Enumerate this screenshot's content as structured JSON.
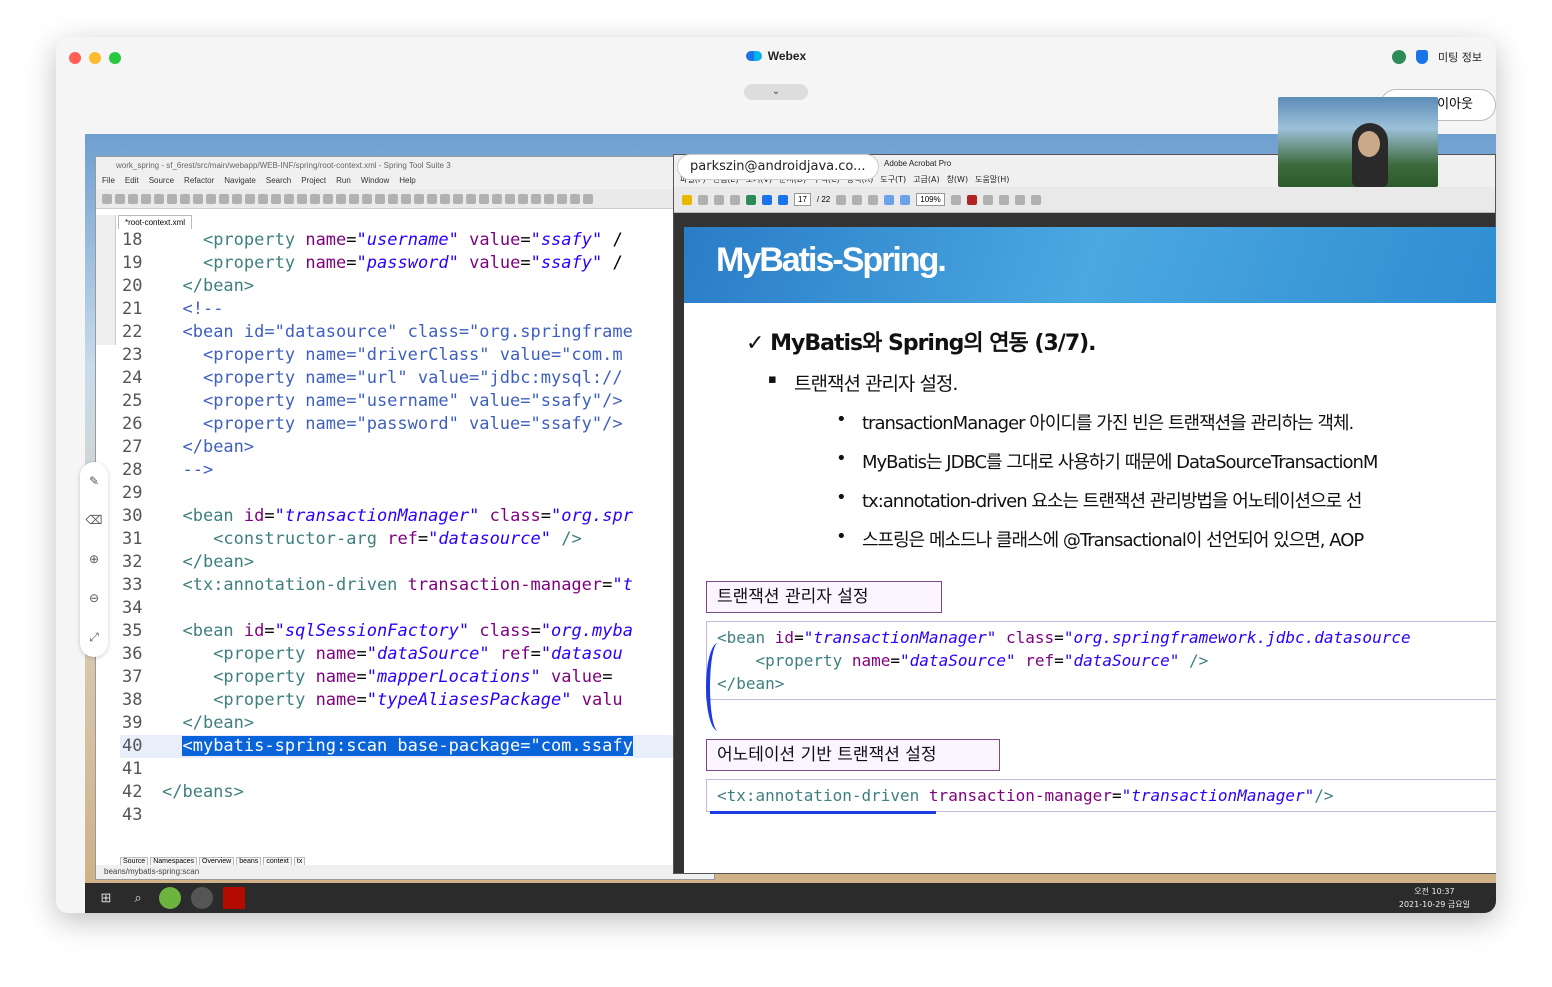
{
  "window": {
    "title": "Webex",
    "collapse_icon": "⌄",
    "meeting_info": "미팅 정보",
    "layout_label": "이아웃"
  },
  "colors": {
    "close": "#ff5f57",
    "minimize": "#febc2e",
    "maximize": "#28c840",
    "highlight": "#0a64d9",
    "annotation": "#1a3ce0"
  },
  "eclipse": {
    "title": "work_spring - sf_6rest/src/main/webapp/WEB-INF/spring/root-context.xml - Spring Tool Suite 3",
    "menu": [
      "File",
      "Edit",
      "Source",
      "Refactor",
      "Navigate",
      "Search",
      "Project",
      "Run",
      "Window",
      "Help"
    ],
    "tab": "*root-context.xml",
    "lines": [
      {
        "n": "18",
        "parts": [
          [
            "p",
            "    "
          ],
          [
            "t",
            "<property"
          ],
          [
            "p",
            " "
          ],
          [
            "a",
            "name"
          ],
          [
            "p",
            "="
          ],
          [
            "v",
            "\"username\""
          ],
          [
            "p",
            " "
          ],
          [
            "a",
            "value"
          ],
          [
            "p",
            "="
          ],
          [
            "v",
            "\"ssafy\""
          ],
          [
            "p",
            " /"
          ]
        ]
      },
      {
        "n": "19",
        "parts": [
          [
            "p",
            "    "
          ],
          [
            "t",
            "<property"
          ],
          [
            "p",
            " "
          ],
          [
            "a",
            "name"
          ],
          [
            "p",
            "="
          ],
          [
            "v",
            "\"password\""
          ],
          [
            "p",
            " "
          ],
          [
            "a",
            "value"
          ],
          [
            "p",
            "="
          ],
          [
            "v",
            "\"ssafy\""
          ],
          [
            "p",
            " /"
          ]
        ]
      },
      {
        "n": "20",
        "parts": [
          [
            "p",
            "  "
          ],
          [
            "t",
            "</bean>"
          ]
        ]
      },
      {
        "n": "21",
        "parts": [
          [
            "p",
            "  "
          ],
          [
            "c",
            "<!--"
          ]
        ]
      },
      {
        "n": "22",
        "parts": [
          [
            "p",
            "  "
          ],
          [
            "c",
            "<bean id=\"datasource\" class=\"org.springframe"
          ]
        ]
      },
      {
        "n": "23",
        "parts": [
          [
            "p",
            "    "
          ],
          [
            "c",
            "<property name=\"driverClass\" value=\"com.m"
          ]
        ]
      },
      {
        "n": "24",
        "parts": [
          [
            "p",
            "    "
          ],
          [
            "c",
            "<property name=\"url\" value=\"jdbc:mysql://"
          ]
        ]
      },
      {
        "n": "25",
        "parts": [
          [
            "p",
            "    "
          ],
          [
            "c",
            "<property name=\"username\" value=\"ssafy\"/>"
          ]
        ]
      },
      {
        "n": "26",
        "parts": [
          [
            "p",
            "    "
          ],
          [
            "c",
            "<property name=\"password\" value=\"ssafy\"/>"
          ]
        ]
      },
      {
        "n": "27",
        "parts": [
          [
            "p",
            "  "
          ],
          [
            "c",
            "</bean>"
          ]
        ]
      },
      {
        "n": "28",
        "parts": [
          [
            "p",
            "  "
          ],
          [
            "c",
            "-->"
          ]
        ]
      },
      {
        "n": "29",
        "parts": []
      },
      {
        "n": "30",
        "parts": [
          [
            "p",
            "  "
          ],
          [
            "t",
            "<bean"
          ],
          [
            "p",
            " "
          ],
          [
            "a",
            "id"
          ],
          [
            "p",
            "="
          ],
          [
            "v",
            "\"transactionManager\""
          ],
          [
            "p",
            " "
          ],
          [
            "a",
            "class"
          ],
          [
            "p",
            "="
          ],
          [
            "v",
            "\"org.spr"
          ]
        ]
      },
      {
        "n": "31",
        "parts": [
          [
            "p",
            "     "
          ],
          [
            "t",
            "<constructor-arg"
          ],
          [
            "p",
            " "
          ],
          [
            "a",
            "ref"
          ],
          [
            "p",
            "="
          ],
          [
            "v",
            "\"datasource\""
          ],
          [
            "p",
            " "
          ],
          [
            "t",
            "/>"
          ]
        ]
      },
      {
        "n": "32",
        "parts": [
          [
            "p",
            "  "
          ],
          [
            "t",
            "</bean>"
          ]
        ]
      },
      {
        "n": "33",
        "parts": [
          [
            "p",
            "  "
          ],
          [
            "t",
            "<tx:annotation-driven"
          ],
          [
            "p",
            " "
          ],
          [
            "a",
            "transaction-manager"
          ],
          [
            "p",
            "="
          ],
          [
            "v",
            "\"t"
          ]
        ]
      },
      {
        "n": "34",
        "parts": []
      },
      {
        "n": "35",
        "parts": [
          [
            "p",
            "  "
          ],
          [
            "t",
            "<bean"
          ],
          [
            "p",
            " "
          ],
          [
            "a",
            "id"
          ],
          [
            "p",
            "="
          ],
          [
            "v",
            "\"sqlSessionFactory\""
          ],
          [
            "p",
            " "
          ],
          [
            "a",
            "class"
          ],
          [
            "p",
            "="
          ],
          [
            "v",
            "\"org.myba"
          ]
        ]
      },
      {
        "n": "36",
        "parts": [
          [
            "p",
            "     "
          ],
          [
            "t",
            "<property"
          ],
          [
            "p",
            " "
          ],
          [
            "a",
            "name"
          ],
          [
            "p",
            "="
          ],
          [
            "v",
            "\"dataSource\""
          ],
          [
            "p",
            " "
          ],
          [
            "a",
            "ref"
          ],
          [
            "p",
            "="
          ],
          [
            "v",
            "\"datasou"
          ]
        ]
      },
      {
        "n": "37",
        "parts": [
          [
            "p",
            "     "
          ],
          [
            "t",
            "<property"
          ],
          [
            "p",
            " "
          ],
          [
            "a",
            "name"
          ],
          [
            "p",
            "="
          ],
          [
            "v",
            "\"mapperLocations\""
          ],
          [
            "p",
            " "
          ],
          [
            "a",
            "value"
          ],
          [
            "p",
            "="
          ]
        ]
      },
      {
        "n": "38",
        "parts": [
          [
            "p",
            "     "
          ],
          [
            "t",
            "<property"
          ],
          [
            "p",
            " "
          ],
          [
            "a",
            "name"
          ],
          [
            "p",
            "="
          ],
          [
            "v",
            "\"typeAliasesPackage\""
          ],
          [
            "p",
            " "
          ],
          [
            "a",
            "valu"
          ]
        ]
      },
      {
        "n": "39",
        "parts": [
          [
            "p",
            "  "
          ],
          [
            "t",
            "</bean>"
          ]
        ]
      },
      {
        "n": "40",
        "hl": true,
        "parts": [
          [
            "p",
            "  "
          ],
          [
            "h",
            "<mybatis-spring:scan base-package=\"com.ssafy"
          ]
        ]
      },
      {
        "n": "41",
        "parts": []
      },
      {
        "n": "42",
        "parts": [
          [
            "t",
            "</beans>"
          ]
        ]
      },
      {
        "n": "43",
        "parts": []
      }
    ],
    "bottom_tabs": [
      "Source",
      "Namespaces",
      "Overview",
      "beans",
      "context",
      "tx"
    ],
    "status": "beans/mybatis-spring:scan"
  },
  "acrobat": {
    "title": "Adobe Acrobat Pro",
    "menu": [
      "파일(F)",
      "편집(E)",
      "보기(V)",
      "문서(D)",
      "주석(C)",
      "양식(R)",
      "도구(T)",
      "고급(A)",
      "창(W)",
      "도움말(H)"
    ],
    "page": "17",
    "pages": "/ 22",
    "zoom": "109%"
  },
  "slide": {
    "banner": "MyBatis-Spring.",
    "heading": "✓ MyBatis와 Spring의 연동 (3/7).",
    "sub": "트랜잭션 관리자 설정.",
    "bullets": [
      "transactionManager 아이디를 가진 빈은 트랜잭션을 관리하는 객체.",
      "MyBatis는 JDBC를 그대로 사용하기 때문에 DataSourceTransactionM",
      "tx:annotation-driven 요소는 트랜잭션 관리방법을 어노테이션으로 선",
      "스프링은 메소드나 클래스에 @Transactional이 선언되어 있으면, AOP"
    ],
    "box1_label": "트랜잭션 관리자 설정",
    "box1_lines": [
      [
        [
          "t",
          "<bean "
        ],
        [
          "a",
          "id"
        ],
        [
          "p",
          "="
        ],
        [
          "v",
          "\"transactionManager\""
        ],
        [
          "p",
          " "
        ],
        [
          "a",
          "class"
        ],
        [
          "p",
          "="
        ],
        [
          "v",
          "\"org.springframework.jdbc.datasource"
        ]
      ],
      [
        [
          "p",
          "    "
        ],
        [
          "t",
          "<property "
        ],
        [
          "a",
          "name"
        ],
        [
          "p",
          "="
        ],
        [
          "v",
          "\"dataSource\""
        ],
        [
          "p",
          " "
        ],
        [
          "a",
          "ref"
        ],
        [
          "p",
          "="
        ],
        [
          "v",
          "\"dataSource\""
        ],
        [
          "p",
          " "
        ],
        [
          "t",
          "/>"
        ]
      ],
      [
        [
          "t",
          "</bean>"
        ]
      ]
    ],
    "box2_label": "어노테이션 기반 트랜잭션 설정",
    "box2_lines": [
      [
        [
          "t",
          "<tx:annotation-driven "
        ],
        [
          "a",
          "transaction-manager"
        ],
        [
          "p",
          "="
        ],
        [
          "v",
          "\"transactionManager\""
        ],
        [
          "t",
          "/>"
        ]
      ]
    ]
  },
  "participant": {
    "email": "parkszin@androidjava.co..."
  },
  "taskbar": {
    "time": "오전 10:37",
    "date": "2021-10-29 금요일"
  }
}
